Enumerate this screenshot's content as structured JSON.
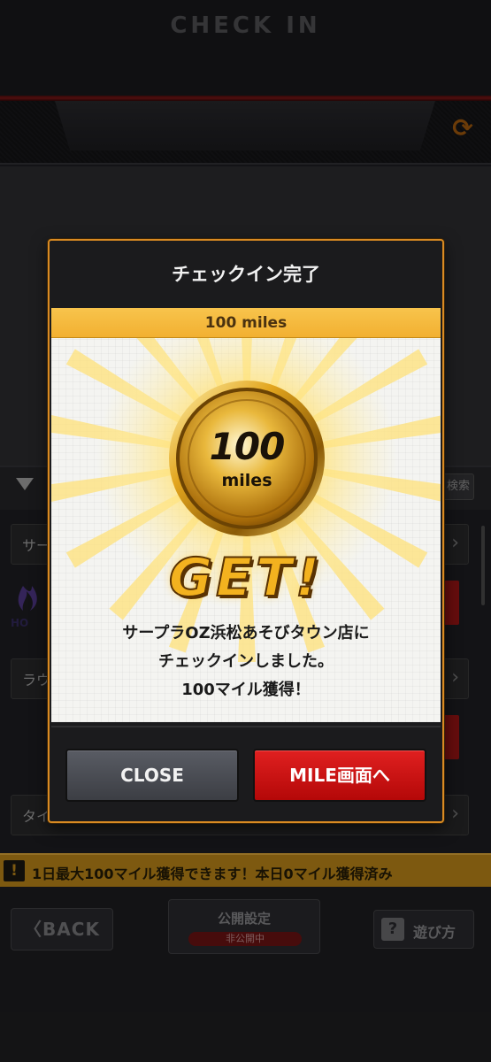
{
  "header": {
    "title": "CHECK IN",
    "refresh_icon": "refresh-icon"
  },
  "filter": {
    "search_label": "検索"
  },
  "list": {
    "items": [
      {
        "label": "サー"
      },
      {
        "label": "ラウ"
      },
      {
        "label": "タイ"
      }
    ]
  },
  "notice": {
    "text": "1日最大100マイル獲得できます！本日0マイル獲得済み"
  },
  "footer": {
    "back_label": "BACK",
    "public_label": "公開設定",
    "public_status": "非公開中",
    "play_label": "遊び方"
  },
  "modal": {
    "title": "チェックイン完了",
    "banner": "100 miles",
    "coin_value": "100",
    "coin_unit": "miles",
    "get": "GET!",
    "message_lines": [
      "サープラOZ浜松あそびタウン店に",
      "チェックインしました。",
      "100マイル獲得！"
    ],
    "close_label": "CLOSE",
    "mile_label": "MILE画面へ"
  },
  "colors": {
    "accent_orange": "#d98a22",
    "banner_gold": "#f2b031",
    "danger_red": "#c01010"
  }
}
